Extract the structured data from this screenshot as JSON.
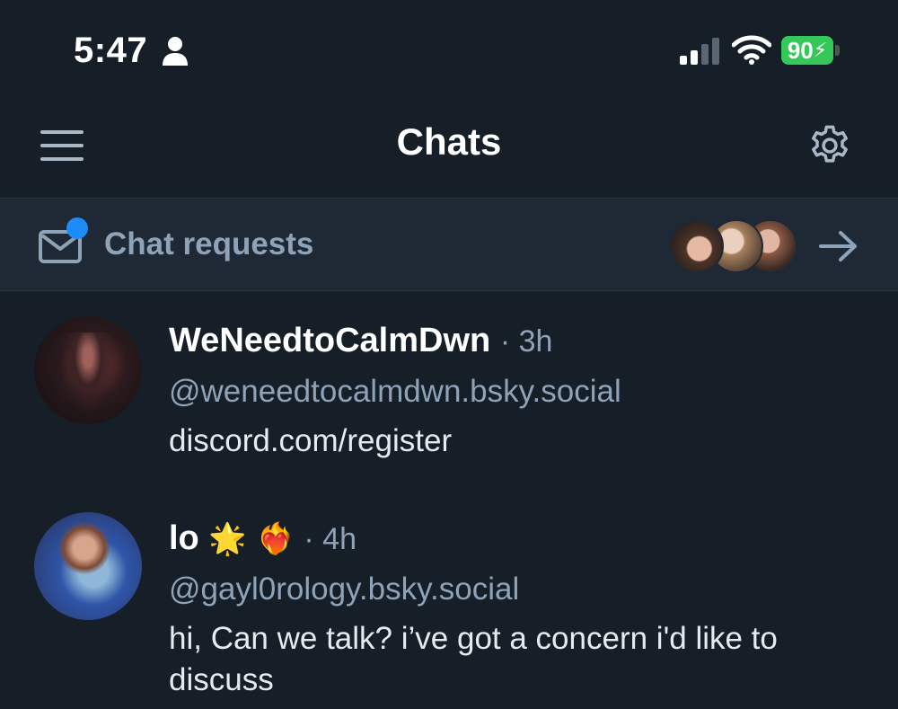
{
  "status_bar": {
    "time": "5:47",
    "battery_level": "90"
  },
  "header": {
    "title": "Chats"
  },
  "chat_requests": {
    "label": "Chat requests"
  },
  "chats": [
    {
      "name": "WeNeedtoCalmDwn",
      "time": "· 3h",
      "handle": "@weneedtocalmdwn.bsky.social",
      "preview": "discord.com/register"
    },
    {
      "name": "lo",
      "emojis": "🌟 ❤️‍🔥",
      "time": "· 4h",
      "handle": "@gayl0rology.bsky.social",
      "preview": "hi, Can we talk? i’ve got a concern i'd like to discuss"
    }
  ],
  "colors": {
    "background": "#161e27",
    "banner": "#1e2935",
    "muted_text": "#8fa3b8",
    "accent_dot": "#1d8cf8",
    "battery": "#34c759"
  }
}
